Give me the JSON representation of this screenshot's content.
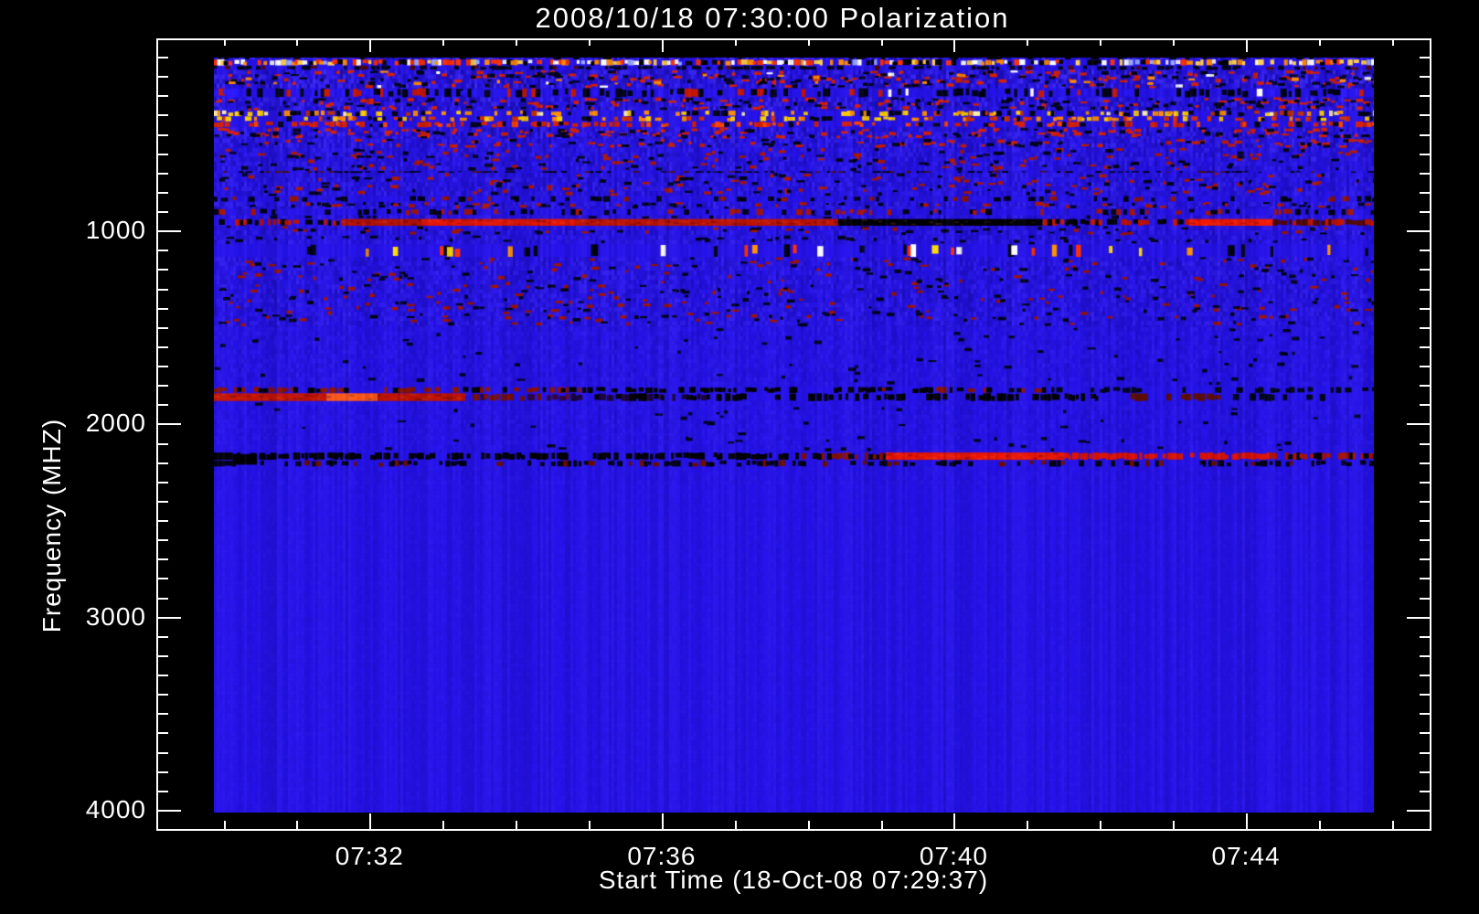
{
  "title": "2008/10/18 07:30:00 Polarization",
  "x_axis": {
    "label": "Start Time (18-Oct-08 07:29:37)",
    "domain_minutes_after_0700": [
      29.08,
      46.54
    ],
    "major_ticks": [
      {
        "minutes": 32,
        "label": "07:32"
      },
      {
        "minutes": 36,
        "label": "07:36"
      },
      {
        "minutes": 40,
        "label": "07:40"
      },
      {
        "minutes": 44,
        "label": "07:44"
      }
    ],
    "minor_ticks_minutes": [
      30,
      31,
      32,
      33,
      34,
      35,
      36,
      37,
      38,
      39,
      40,
      41,
      42,
      43,
      44,
      45,
      46
    ]
  },
  "y_axis": {
    "label": "Frequency (MHZ)",
    "domain_mhz": [
      5,
      4109
    ],
    "major_ticks": [
      {
        "mhz": 1000,
        "label": "1000"
      },
      {
        "mhz": 2000,
        "label": "2000"
      },
      {
        "mhz": 3000,
        "label": "3000"
      },
      {
        "mhz": 4000,
        "label": "4000"
      }
    ],
    "minor_step_mhz": 100
  },
  "colors": {
    "background": "#000000",
    "axis": "#ffffff",
    "text": "#ffffff",
    "quiet_continuum": "#2613ea"
  },
  "chart_data": {
    "type": "heatmap",
    "title": "2008/10/18 07:30:00 Polarization",
    "xlabel": "Start Time (18-Oct-08 07:29:37)",
    "ylabel": "Frequency (MHZ)",
    "x_tick_labels": [
      "07:32",
      "07:36",
      "07:40",
      "07:44"
    ],
    "y_tick_labels": [
      "1000",
      "2000",
      "3000",
      "4000"
    ],
    "time_extent_minutes_after_0700": [
      29.86,
      45.73
    ],
    "freq_extent_mhz": [
      104,
      4019
    ],
    "features": [
      {
        "freq_mhz": 130,
        "desc": "bright broadband dashed band (white/yellow/orange) at top of spectrum"
      },
      {
        "freq_mhz": 290,
        "desc": "dark dashed interference row with sparse white and red bursts"
      },
      {
        "freq_mhz": 400,
        "desc": "dense yellow/orange speckled RFI band"
      },
      {
        "freq_mhz": 450,
        "desc": "red speckled row"
      },
      {
        "freq_mhz": 950,
        "desc": "strong horizontal line: red on left, saturated black 07:38-07:41, bright red again near 07:43-07:44"
      },
      {
        "freq_mhz": 1100,
        "desc": "sparse multicolor speckle row (red/orange/yellow/white)"
      },
      {
        "freq_mhz": 1870,
        "desc": "bright orange-red streak strongest before 07:33, fading into dark/black dashes toward 07:42"
      },
      {
        "freq_mhz": 2170,
        "desc": "strong line: black dashes on left half, solid bright red 07:39-07:41.5, red dashes to end; small solid black blob near 07:30"
      },
      {
        "freq_mhz": 3000,
        "desc": "smooth quiet blue continuum with faint vertical column striping below ~2250 MHz"
      }
    ],
    "bands": [
      {
        "kind": "noise",
        "f0": 104,
        "f1": 113,
        "amp": 0.5,
        "speckles": [
          {
            "c": "#000000",
            "d": 0.2
          }
        ]
      },
      {
        "kind": "dash",
        "f0": 113,
        "f1": 145,
        "d": 0.88,
        "palette": [
          {
            "c": "#ffffff",
            "w": 3
          },
          {
            "c": "#ffd24a",
            "w": 3
          },
          {
            "c": "#ff8c00",
            "w": 2
          },
          {
            "c": "#ff3000",
            "w": 3
          },
          {
            "c": "#99aaff",
            "w": 1
          },
          {
            "c": "#000000",
            "w": 2
          }
        ]
      },
      {
        "kind": "dash",
        "f0": 145,
        "f1": 168,
        "d": 0.5,
        "palette": [
          {
            "c": "#000318",
            "w": 4
          },
          {
            "c": "#500800",
            "w": 1
          }
        ]
      },
      {
        "kind": "noise",
        "f0": 168,
        "f1": 263,
        "amp": 0.4,
        "speckles": [
          {
            "c": "#d82000",
            "d": 0.1
          },
          {
            "c": "#000418",
            "d": 0.09
          },
          {
            "c": "#ff8c00",
            "d": 0.015
          },
          {
            "c": "#ffffff",
            "d": 0.006
          }
        ]
      },
      {
        "kind": "dash",
        "f0": 263,
        "f1": 310,
        "d": 0.5,
        "palette": [
          {
            "c": "#000312",
            "w": 5
          },
          {
            "c": "#c81800",
            "w": 2
          },
          {
            "c": "#ffffff",
            "w": 0.4
          },
          {
            "c": "#2a18ff",
            "w": 2
          }
        ]
      },
      {
        "kind": "noise",
        "f0": 310,
        "f1": 378,
        "amp": 0.35,
        "speckles": [
          {
            "c": "#d82000",
            "d": 0.1
          },
          {
            "c": "#000418",
            "d": 0.1
          }
        ]
      },
      {
        "kind": "dash",
        "f0": 378,
        "f1": 408,
        "d": 0.6,
        "palette": [
          {
            "c": "#ffd000",
            "w": 3
          },
          {
            "c": "#ff9000",
            "w": 2
          },
          {
            "c": "#fff2a8",
            "w": 1
          },
          {
            "c": "#000310",
            "w": 2.5
          },
          {
            "c": "#c03000",
            "w": 1
          }
        ]
      },
      {
        "kind": "dash",
        "f0": 408,
        "f1": 435,
        "d": 0.5,
        "palette": [
          {
            "c": "#ffd000",
            "w": 2
          },
          {
            "c": "#ff8800",
            "w": 2
          },
          {
            "c": "#000310",
            "w": 2
          },
          {
            "c": "#d83000",
            "w": 2
          },
          {
            "c": "#2515d8",
            "w": 2
          }
        ]
      },
      {
        "kind": "dash",
        "f0": 435,
        "f1": 466,
        "d": 0.5,
        "palette": [
          {
            "c": "#d82000",
            "w": 3
          },
          {
            "c": "#ff4400",
            "w": 1
          },
          {
            "c": "#000515",
            "w": 1
          }
        ]
      },
      {
        "kind": "noise",
        "f0": 466,
        "f1": 524,
        "amp": 0.33,
        "speckles": [
          {
            "c": "#d82000",
            "d": 0.13
          },
          {
            "c": "#000418",
            "d": 0.07
          }
        ]
      },
      {
        "kind": "noise",
        "f0": 524,
        "f1": 572,
        "amp": 0.3,
        "speckles": [
          {
            "c": "#c81e00",
            "d": 0.09
          },
          {
            "c": "#000418",
            "d": 0.05
          }
        ]
      },
      {
        "kind": "noise",
        "f0": 572,
        "f1": 692,
        "amp": 0.25,
        "speckles": [
          {
            "c": "#b01800",
            "d": 0.05
          },
          {
            "c": "#000418",
            "d": 0.05
          }
        ]
      },
      {
        "kind": "dash",
        "f0": 692,
        "f1": 702,
        "d": 0.45,
        "palette": [
          {
            "c": "#000310",
            "w": 3
          },
          {
            "c": "#501000",
            "w": 1
          }
        ]
      },
      {
        "kind": "noise",
        "f0": 702,
        "f1": 822,
        "amp": 0.24,
        "speckles": [
          {
            "c": "#b01800",
            "d": 0.05
          },
          {
            "c": "#000418",
            "d": 0.04
          }
        ]
      },
      {
        "kind": "dash",
        "f0": 822,
        "f1": 852,
        "d": 0.35,
        "palette": [
          {
            "c": "#000312",
            "w": 3
          },
          {
            "c": "#901400",
            "w": 1
          },
          {
            "c": "#2515d0",
            "w": 1
          }
        ]
      },
      {
        "kind": "noise",
        "f0": 852,
        "f1": 888,
        "amp": 0.28,
        "speckles": [
          {
            "c": "#000418",
            "d": 0.08
          },
          {
            "c": "#b01800",
            "d": 0.06
          }
        ]
      },
      {
        "kind": "dash",
        "f0": 888,
        "f1": 922,
        "d": 0.4,
        "palette": [
          {
            "c": "#000312",
            "w": 3
          },
          {
            "c": "#a81600",
            "w": 2
          },
          {
            "c": "#2515d0",
            "w": 1
          }
        ]
      },
      {
        "kind": "noise",
        "f0": 922,
        "f1": 940,
        "amp": 0.25,
        "speckles": [
          {
            "c": "#000418",
            "d": 0.05
          }
        ]
      },
      {
        "kind": "line",
        "f0": 941,
        "f1": 976,
        "segs": [
          {
            "t0": 29.86,
            "t1": 30.6,
            "style": "dash",
            "c": "#000000",
            "c2": "#c41400",
            "d": 0.55
          },
          {
            "t0": 30.6,
            "t1": 31.6,
            "style": "dash",
            "c": "#b81200",
            "c2": "#000000",
            "d": 0.8
          },
          {
            "t0": 31.6,
            "t1": 32.7,
            "style": "solid",
            "c": "#b81200"
          },
          {
            "t0": 32.7,
            "t1": 34.8,
            "style": "solid",
            "c": "#e61600"
          },
          {
            "t0": 34.8,
            "t1": 38.4,
            "style": "solid",
            "c": "#c01300"
          },
          {
            "t0": 38.4,
            "t1": 41.2,
            "style": "solid",
            "c": "#010101"
          },
          {
            "t0": 41.2,
            "t1": 43.2,
            "style": "dash",
            "c": "#000000",
            "c2": "#c41400",
            "d": 0.75
          },
          {
            "t0": 43.2,
            "t1": 44.35,
            "style": "solid",
            "c": "#f71900"
          },
          {
            "t0": 44.35,
            "t1": 45.73,
            "style": "dash",
            "c": "#c01300",
            "c2": "#500800",
            "d": 0.85
          }
        ]
      },
      {
        "kind": "noise",
        "f0": 976,
        "f1": 1026,
        "amp": 0.24,
        "speckles": [
          {
            "c": "#000418",
            "d": 0.05
          },
          {
            "c": "#a01400",
            "d": 0.03
          }
        ]
      },
      {
        "kind": "noise",
        "f0": 1026,
        "f1": 1072,
        "amp": 0.22,
        "speckles": [
          {
            "c": "#000418",
            "d": 0.06
          }
        ]
      },
      {
        "kind": "dash",
        "f0": 1072,
        "f1": 1138,
        "d": 0.16,
        "palette": [
          {
            "c": "#ff3000",
            "w": 3
          },
          {
            "c": "#ff9400",
            "w": 2
          },
          {
            "c": "#ffe000",
            "w": 2
          },
          {
            "c": "#ffffff",
            "w": 1
          },
          {
            "c": "#000310",
            "w": 3
          }
        ]
      },
      {
        "kind": "noise",
        "f0": 1138,
        "f1": 1500,
        "amp": 0.22,
        "speckles": [
          {
            "c": "#a01400",
            "d": 0.035
          },
          {
            "c": "#000418",
            "d": 0.035
          }
        ]
      },
      {
        "kind": "noise",
        "f0": 1500,
        "f1": 1805,
        "amp": 0.13,
        "speckles": [
          {
            "c": "#000420",
            "d": 0.015
          }
        ]
      },
      {
        "kind": "line",
        "f0": 1812,
        "f1": 1843,
        "segs": [
          {
            "t0": 29.86,
            "t1": 34.9,
            "style": "dash",
            "c": "#8a1200",
            "c2": "#000000",
            "d": 0.55
          },
          {
            "t0": 34.9,
            "t1": 37.6,
            "style": "dash",
            "c": "#000000",
            "d": 0.55
          },
          {
            "t0": 37.6,
            "t1": 41.2,
            "style": "dash",
            "c": "#000000",
            "c2": "#8a1200",
            "d": 0.5
          },
          {
            "t0": 41.2,
            "t1": 45.73,
            "style": "dash",
            "c": "#000616",
            "d": 0.3
          }
        ]
      },
      {
        "kind": "line",
        "f0": 1845,
        "f1": 1885,
        "segs": [
          {
            "t0": 29.86,
            "t1": 31.4,
            "style": "solid",
            "c": "#c81500"
          },
          {
            "t0": 31.4,
            "t1": 32.1,
            "style": "solid",
            "c": "#ff5a18"
          },
          {
            "t0": 32.1,
            "t1": 33.3,
            "style": "solid",
            "c": "#c01300"
          },
          {
            "t0": 33.3,
            "t1": 34.7,
            "style": "dash",
            "c": "#7a1000",
            "c2": "#300640",
            "d": 0.7
          },
          {
            "t0": 34.7,
            "t1": 36.6,
            "style": "dash",
            "c": "#1a0536",
            "c2": "#000000",
            "d": 0.6
          },
          {
            "t0": 36.6,
            "t1": 42.4,
            "style": "dash",
            "c": "#000000",
            "d": 0.45
          },
          {
            "t0": 42.4,
            "t1": 43.6,
            "style": "dash",
            "c": "#601000",
            "d": 0.4
          },
          {
            "t0": 43.6,
            "t1": 45.73,
            "style": "dash",
            "c": "#000616",
            "d": 0.2
          }
        ]
      },
      {
        "kind": "noise",
        "f0": 1885,
        "f1": 2065,
        "amp": 0.11,
        "speckles": [
          {
            "c": "#000420",
            "d": 0.01
          }
        ]
      },
      {
        "kind": "noise",
        "f0": 2065,
        "f1": 2148,
        "amp": 0.1,
        "speckles": [
          {
            "c": "#000418",
            "d": 0.02
          }
        ]
      },
      {
        "kind": "line",
        "f0": 2152,
        "f1": 2190,
        "segs": [
          {
            "t0": 29.86,
            "t1": 30.12,
            "style": "solid",
            "c": "#000000"
          },
          {
            "t0": 30.12,
            "t1": 31.9,
            "style": "dash",
            "c": "#000000",
            "d": 0.8
          },
          {
            "t0": 31.9,
            "t1": 34.0,
            "style": "dash",
            "c": "#000000",
            "d": 0.65
          },
          {
            "t0": 34.0,
            "t1": 37.9,
            "style": "dash",
            "c": "#000000",
            "d": 0.7
          },
          {
            "t0": 37.9,
            "t1": 39.05,
            "style": "dash",
            "c": "#8a1000",
            "c2": "#000000",
            "d": 0.75
          },
          {
            "t0": 39.05,
            "t1": 41.5,
            "style": "solid",
            "c": "#ee1600"
          },
          {
            "t0": 41.5,
            "t1": 44.3,
            "style": "dash",
            "c": "#e01400",
            "d": 0.85
          },
          {
            "t0": 44.3,
            "t1": 45.73,
            "style": "dash",
            "c": "#a81200",
            "c2": "#000000",
            "d": 0.8
          }
        ]
      },
      {
        "kind": "blob",
        "f0": 2160,
        "f1": 2215,
        "t0": 30.12,
        "t1": 30.45,
        "c": "#000000"
      },
      {
        "kind": "dash",
        "f0": 2192,
        "f1": 2225,
        "d": 0.5,
        "palette": [
          {
            "c": "#000212",
            "w": 4
          },
          {
            "c": "#6a0e00",
            "w": 1
          }
        ]
      },
      {
        "kind": "noise",
        "f0": 2225,
        "f1": 2320,
        "amp": 0.08,
        "speckles": []
      },
      {
        "kind": "noise",
        "f0": 2320,
        "f1": 4019,
        "amp": 0.05,
        "speckles": []
      }
    ]
  }
}
